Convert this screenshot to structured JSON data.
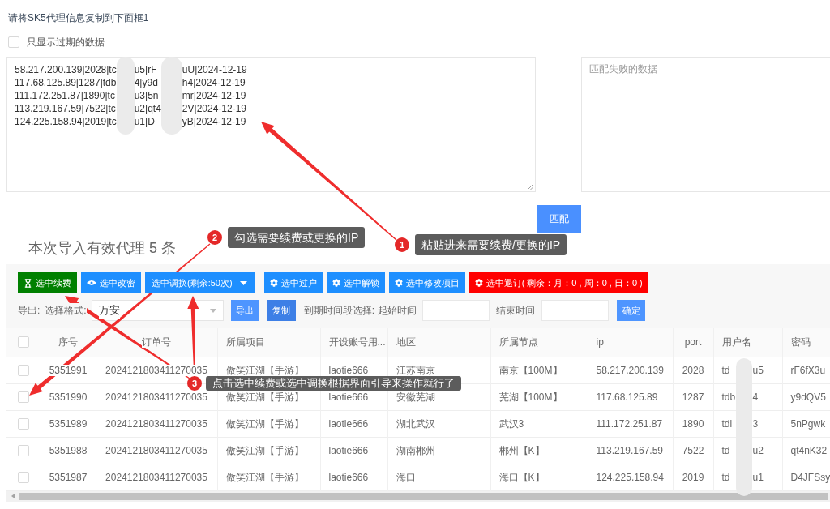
{
  "instruction": "请将SK5代理信息复制到下面框1",
  "expired_only": {
    "label": "只显示过期的数据",
    "checked": false
  },
  "proxy_input": {
    "lines": [
      [
        "58.217.200.139|2028|tc",
        "u5|rF",
        "uU|2024-12-19"
      ],
      [
        "117.68.125.89|1287|tdb",
        "4|y9d",
        "h4|2024-12-19"
      ],
      [
        "111.172.251.87|1890|tc",
        "u3|5n",
        "mr|2024-12-19"
      ],
      [
        "113.219.167.59|7522|tc",
        "u2|qt4",
        "2V|2024-12-19"
      ],
      [
        "124.225.158.94|2019|tc",
        "u1|D",
        "yB|2024-12-19"
      ]
    ]
  },
  "failed_output": {
    "placeholder": "匹配失败的数据"
  },
  "match_button": "匹配",
  "summary": "本次导入有效代理 5 条",
  "actions": [
    {
      "label": "选中续费",
      "kind": "hourglass",
      "color": "#008000"
    },
    {
      "label": "选中改密",
      "kind": "eye",
      "color": "#1e8fff"
    },
    {
      "label": "选中调换(剩余:50次)",
      "kind": "menu",
      "color": "#1e8fff"
    },
    {
      "label": "选中过户",
      "kind": "gear",
      "color": "#1e8fff"
    },
    {
      "label": "选中解锁",
      "kind": "gear",
      "color": "#1e8fff"
    },
    {
      "label": "选中修改项目",
      "kind": "gear",
      "color": "#1e8fff"
    },
    {
      "label": "选中退订( 剩余：月：0 , 周：0 , 日：0 )",
      "kind": "gear",
      "color": "#ff0000"
    }
  ],
  "export_bar": {
    "export_label": "导出:",
    "format_label": "选择格式:",
    "format": {
      "value": "万安"
    },
    "export_button": "导出",
    "copy_button": "复制",
    "range_label": "到期时间段选择:",
    "start_label": "起始时间",
    "end_label": "结束时间",
    "confirm_button": "确定"
  },
  "table": {
    "select_all": {
      "checked": false
    },
    "columns": [
      "序号",
      "订单号",
      "所属项目",
      "开设账号用...",
      "地区",
      "所属节点",
      "ip",
      "port",
      "用户名",
      "密码"
    ],
    "rows": [
      {
        "selected": false,
        "serial": "5351991",
        "order_no": "2024121803411270035",
        "project": "傲笑江湖【手游】",
        "account": "laotie666",
        "region": "江苏南京",
        "node": "南京【100M】",
        "ip": "58.217.200.139",
        "port": "2028",
        "username": [
          "td",
          "u5"
        ],
        "password": "rF6fX3u"
      },
      {
        "selected": false,
        "serial": "5351990",
        "order_no": "2024121803411270035",
        "project": "傲笑江湖【手游】",
        "account": "laotie666",
        "region": "安徽芜湖",
        "node": "芜湖【100M】",
        "ip": "117.68.125.89",
        "port": "1287",
        "username": [
          "tdb",
          "4"
        ],
        "password": "y9dQV5"
      },
      {
        "selected": false,
        "serial": "5351989",
        "order_no": "2024121803411270035",
        "project": "傲笑江湖【手游】",
        "account": "laotie666",
        "region": "湖北武汉",
        "node": "武汉3",
        "ip": "111.172.251.87",
        "port": "1890",
        "username": [
          "tdl",
          "3"
        ],
        "password": "5nPgwk"
      },
      {
        "selected": false,
        "serial": "5351988",
        "order_no": "2024121803411270035",
        "project": "傲笑江湖【手游】",
        "account": "laotie666",
        "region": "湖南郴州",
        "node": "郴州【K】",
        "ip": "113.219.167.59",
        "port": "7522",
        "username": [
          "td",
          "u2"
        ],
        "password": "qt4nK32"
      },
      {
        "selected": false,
        "serial": "5351987",
        "order_no": "2024121803411270035",
        "project": "傲笑江湖【手游】",
        "account": "laotie666",
        "region": "海口",
        "node": "海口【K】",
        "ip": "124.225.158.94",
        "port": "2019",
        "username": [
          "td",
          "u1"
        ],
        "password": "D4JFSsy"
      }
    ]
  },
  "annotations": [
    {
      "number": "1",
      "text": "粘贴进来需要续费/更换的IP"
    },
    {
      "number": "2",
      "text": "勾选需要续费或更换的IP"
    },
    {
      "number": "3",
      "text": "点击选中续费或选中调换根据界面引导来操作就行了"
    }
  ]
}
